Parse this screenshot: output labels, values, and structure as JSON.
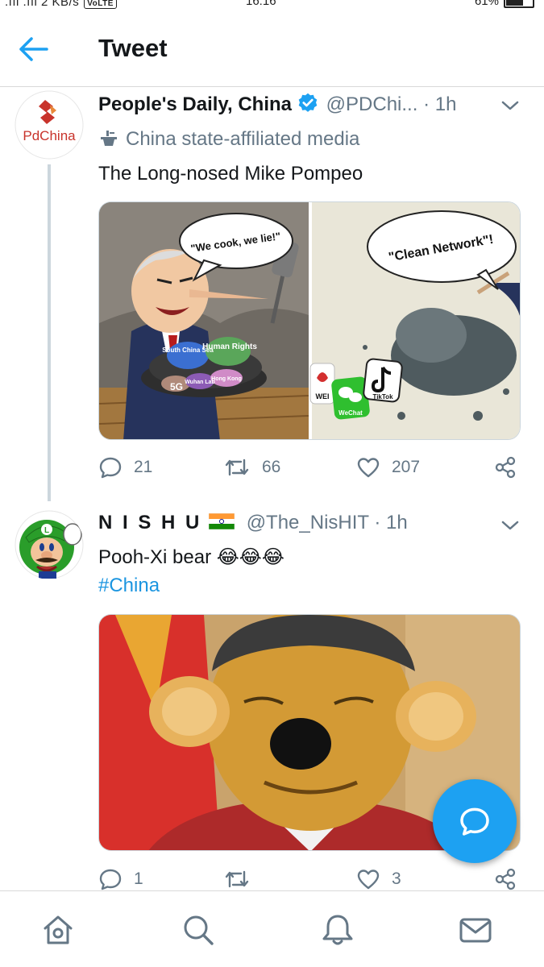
{
  "status_bar": {
    "left_text": ".ııl .ııl 2 KB/s",
    "volte_badge": "VoLTE",
    "time": "16:16",
    "battery_text": "61%",
    "battery_level": 0.61
  },
  "header": {
    "title": "Tweet",
    "back_icon": "arrow-left-icon"
  },
  "colors": {
    "accent": "#1da1f2",
    "link": "#1b95e0",
    "muted": "#657786",
    "divider": "#ccd6dd"
  },
  "tweets": [
    {
      "display_name": "People's Daily, China",
      "verified": true,
      "handle": "@PDChi...",
      "dot": "·",
      "time": "1h",
      "avatar_text": "PdChina",
      "state_label": "China state-affiliated media",
      "state_icon": "podium-icon",
      "text": "The Long-nosed Mike Pompeo",
      "media": {
        "left_bubble": "\"We cook, we lie!\"",
        "right_bubble": "\"Clean Network\"!",
        "pan_labels": [
          "South China Sea",
          "Human Rights",
          "5G",
          "Wuhan Lab",
          "Hong Kong"
        ],
        "app_labels": [
          "WEI",
          "WeChat",
          "TikTok"
        ]
      },
      "replies": "21",
      "retweets": "66",
      "likes": "207"
    },
    {
      "display_name": "N I S H U",
      "flag_icon": "india-flag-icon",
      "handle": "@The_NisHIT",
      "dot": "·",
      "time": "1h",
      "text": "Pooh-Xi bear",
      "emojis": "😂😂😂",
      "hashtag": "#China",
      "replies": "1",
      "retweets": "",
      "likes": "3"
    }
  ],
  "bottom_nav": [
    {
      "name": "home",
      "icon": "home-icon"
    },
    {
      "name": "search",
      "icon": "search-icon"
    },
    {
      "name": "notifications",
      "icon": "bell-icon"
    },
    {
      "name": "messages",
      "icon": "mail-icon"
    }
  ],
  "fab": {
    "icon": "compose-reply-icon"
  }
}
